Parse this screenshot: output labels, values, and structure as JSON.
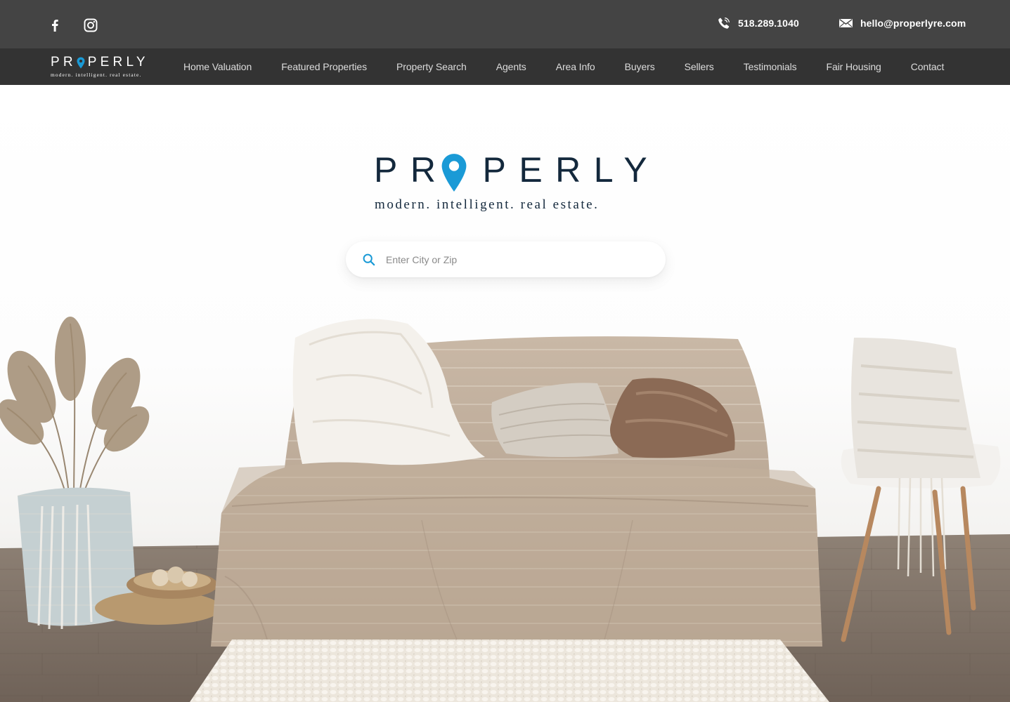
{
  "topbar": {
    "phone": "518.289.1040",
    "email": "hello@properlyre.com",
    "icons": {
      "facebook": "facebook-icon",
      "instagram": "instagram-icon",
      "phone": "phone-icon",
      "email": "envelope-icon"
    }
  },
  "brand": {
    "wordmark_left": "PR",
    "wordmark_right": "PERLY",
    "tagline": "modern. intelligent. real estate.",
    "pin_color": "#1a9ad6",
    "text_color": "#13283c"
  },
  "nav": {
    "items": [
      {
        "label": "Home Valuation"
      },
      {
        "label": "Featured Properties"
      },
      {
        "label": "Property Search"
      },
      {
        "label": "Agents"
      },
      {
        "label": "Area Info"
      },
      {
        "label": "Buyers"
      },
      {
        "label": "Sellers"
      },
      {
        "label": "Testimonials"
      },
      {
        "label": "Fair Housing"
      },
      {
        "label": "Contact"
      }
    ]
  },
  "search": {
    "placeholder": "Enter City or Zip",
    "value": "",
    "icon": "search-icon",
    "icon_color": "#1a9ad6"
  },
  "colors": {
    "topbar_bg": "#444444",
    "navbar_bg": "#333333",
    "accent": "#1a9ad6"
  }
}
